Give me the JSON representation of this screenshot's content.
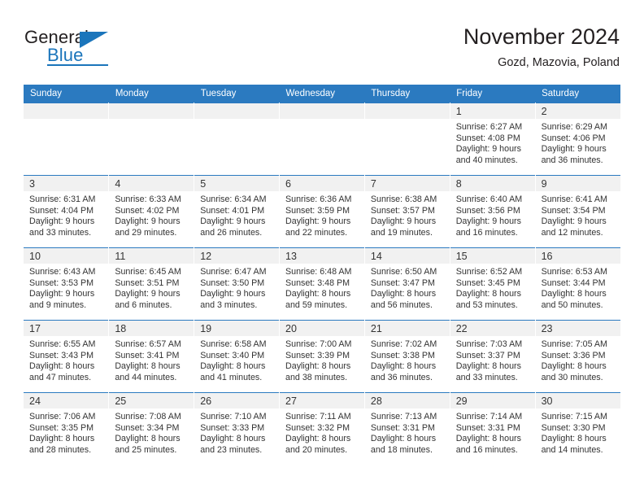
{
  "brand": {
    "name_part1": "General",
    "name_part2": "Blue",
    "logo_icon": "triangle-flag-icon",
    "accent_color": "#1b75bb"
  },
  "header": {
    "title": "November 2024",
    "subtitle": "Gozd, Mazovia, Poland"
  },
  "calendar": {
    "header_color": "#2b7ac0",
    "daynum_band_color": "#f1f1f1",
    "weekdays": [
      "Sunday",
      "Monday",
      "Tuesday",
      "Wednesday",
      "Thursday",
      "Friday",
      "Saturday"
    ],
    "weeks": [
      [
        {
          "day": "",
          "empty": true
        },
        {
          "day": "",
          "empty": true
        },
        {
          "day": "",
          "empty": true
        },
        {
          "day": "",
          "empty": true
        },
        {
          "day": "",
          "empty": true
        },
        {
          "day": "1",
          "sunrise": "Sunrise: 6:27 AM",
          "sunset": "Sunset: 4:08 PM",
          "daylight": "Daylight: 9 hours and 40 minutes."
        },
        {
          "day": "2",
          "sunrise": "Sunrise: 6:29 AM",
          "sunset": "Sunset: 4:06 PM",
          "daylight": "Daylight: 9 hours and 36 minutes."
        }
      ],
      [
        {
          "day": "3",
          "sunrise": "Sunrise: 6:31 AM",
          "sunset": "Sunset: 4:04 PM",
          "daylight": "Daylight: 9 hours and 33 minutes."
        },
        {
          "day": "4",
          "sunrise": "Sunrise: 6:33 AM",
          "sunset": "Sunset: 4:02 PM",
          "daylight": "Daylight: 9 hours and 29 minutes."
        },
        {
          "day": "5",
          "sunrise": "Sunrise: 6:34 AM",
          "sunset": "Sunset: 4:01 PM",
          "daylight": "Daylight: 9 hours and 26 minutes."
        },
        {
          "day": "6",
          "sunrise": "Sunrise: 6:36 AM",
          "sunset": "Sunset: 3:59 PM",
          "daylight": "Daylight: 9 hours and 22 minutes."
        },
        {
          "day": "7",
          "sunrise": "Sunrise: 6:38 AM",
          "sunset": "Sunset: 3:57 PM",
          "daylight": "Daylight: 9 hours and 19 minutes."
        },
        {
          "day": "8",
          "sunrise": "Sunrise: 6:40 AM",
          "sunset": "Sunset: 3:56 PM",
          "daylight": "Daylight: 9 hours and 16 minutes."
        },
        {
          "day": "9",
          "sunrise": "Sunrise: 6:41 AM",
          "sunset": "Sunset: 3:54 PM",
          "daylight": "Daylight: 9 hours and 12 minutes."
        }
      ],
      [
        {
          "day": "10",
          "sunrise": "Sunrise: 6:43 AM",
          "sunset": "Sunset: 3:53 PM",
          "daylight": "Daylight: 9 hours and 9 minutes."
        },
        {
          "day": "11",
          "sunrise": "Sunrise: 6:45 AM",
          "sunset": "Sunset: 3:51 PM",
          "daylight": "Daylight: 9 hours and 6 minutes."
        },
        {
          "day": "12",
          "sunrise": "Sunrise: 6:47 AM",
          "sunset": "Sunset: 3:50 PM",
          "daylight": "Daylight: 9 hours and 3 minutes."
        },
        {
          "day": "13",
          "sunrise": "Sunrise: 6:48 AM",
          "sunset": "Sunset: 3:48 PM",
          "daylight": "Daylight: 8 hours and 59 minutes."
        },
        {
          "day": "14",
          "sunrise": "Sunrise: 6:50 AM",
          "sunset": "Sunset: 3:47 PM",
          "daylight": "Daylight: 8 hours and 56 minutes."
        },
        {
          "day": "15",
          "sunrise": "Sunrise: 6:52 AM",
          "sunset": "Sunset: 3:45 PM",
          "daylight": "Daylight: 8 hours and 53 minutes."
        },
        {
          "day": "16",
          "sunrise": "Sunrise: 6:53 AM",
          "sunset": "Sunset: 3:44 PM",
          "daylight": "Daylight: 8 hours and 50 minutes."
        }
      ],
      [
        {
          "day": "17",
          "sunrise": "Sunrise: 6:55 AM",
          "sunset": "Sunset: 3:43 PM",
          "daylight": "Daylight: 8 hours and 47 minutes."
        },
        {
          "day": "18",
          "sunrise": "Sunrise: 6:57 AM",
          "sunset": "Sunset: 3:41 PM",
          "daylight": "Daylight: 8 hours and 44 minutes."
        },
        {
          "day": "19",
          "sunrise": "Sunrise: 6:58 AM",
          "sunset": "Sunset: 3:40 PM",
          "daylight": "Daylight: 8 hours and 41 minutes."
        },
        {
          "day": "20",
          "sunrise": "Sunrise: 7:00 AM",
          "sunset": "Sunset: 3:39 PM",
          "daylight": "Daylight: 8 hours and 38 minutes."
        },
        {
          "day": "21",
          "sunrise": "Sunrise: 7:02 AM",
          "sunset": "Sunset: 3:38 PM",
          "daylight": "Daylight: 8 hours and 36 minutes."
        },
        {
          "day": "22",
          "sunrise": "Sunrise: 7:03 AM",
          "sunset": "Sunset: 3:37 PM",
          "daylight": "Daylight: 8 hours and 33 minutes."
        },
        {
          "day": "23",
          "sunrise": "Sunrise: 7:05 AM",
          "sunset": "Sunset: 3:36 PM",
          "daylight": "Daylight: 8 hours and 30 minutes."
        }
      ],
      [
        {
          "day": "24",
          "sunrise": "Sunrise: 7:06 AM",
          "sunset": "Sunset: 3:35 PM",
          "daylight": "Daylight: 8 hours and 28 minutes."
        },
        {
          "day": "25",
          "sunrise": "Sunrise: 7:08 AM",
          "sunset": "Sunset: 3:34 PM",
          "daylight": "Daylight: 8 hours and 25 minutes."
        },
        {
          "day": "26",
          "sunrise": "Sunrise: 7:10 AM",
          "sunset": "Sunset: 3:33 PM",
          "daylight": "Daylight: 8 hours and 23 minutes."
        },
        {
          "day": "27",
          "sunrise": "Sunrise: 7:11 AM",
          "sunset": "Sunset: 3:32 PM",
          "daylight": "Daylight: 8 hours and 20 minutes."
        },
        {
          "day": "28",
          "sunrise": "Sunrise: 7:13 AM",
          "sunset": "Sunset: 3:31 PM",
          "daylight": "Daylight: 8 hours and 18 minutes."
        },
        {
          "day": "29",
          "sunrise": "Sunrise: 7:14 AM",
          "sunset": "Sunset: 3:31 PM",
          "daylight": "Daylight: 8 hours and 16 minutes."
        },
        {
          "day": "30",
          "sunrise": "Sunrise: 7:15 AM",
          "sunset": "Sunset: 3:30 PM",
          "daylight": "Daylight: 8 hours and 14 minutes."
        }
      ]
    ]
  }
}
